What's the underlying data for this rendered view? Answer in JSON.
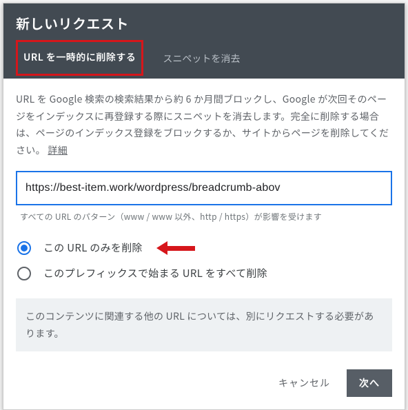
{
  "header": {
    "title": "新しいリクエスト",
    "tabs": {
      "active": "URL を一時的に削除する",
      "inactive": "スニペットを消去"
    }
  },
  "main": {
    "description": "URL を Google 検索の検索結果から約 6 か月間ブロックし、Google が次回そのページをインデックスに再登録する際にスニペットを消去します。完全に削除する場合は、ページのインデックス登録をブロックするか、サイトからページを削除してください。",
    "more_label": "詳細",
    "url_value": "https://best-item.work/wordpress/breadcrumb-abov",
    "hint": "すべての URL のパターン（www / www 以外、http / https）が影響を受けます",
    "radios": {
      "opt1": "この URL のみを削除",
      "opt2": "このプレフィックスで始まる URL をすべて削除"
    },
    "notice": "このコンテンツに関連する他の URL については、別にリクエストする必要があります。"
  },
  "footer": {
    "cancel": "キャンセル",
    "next": "次へ"
  }
}
